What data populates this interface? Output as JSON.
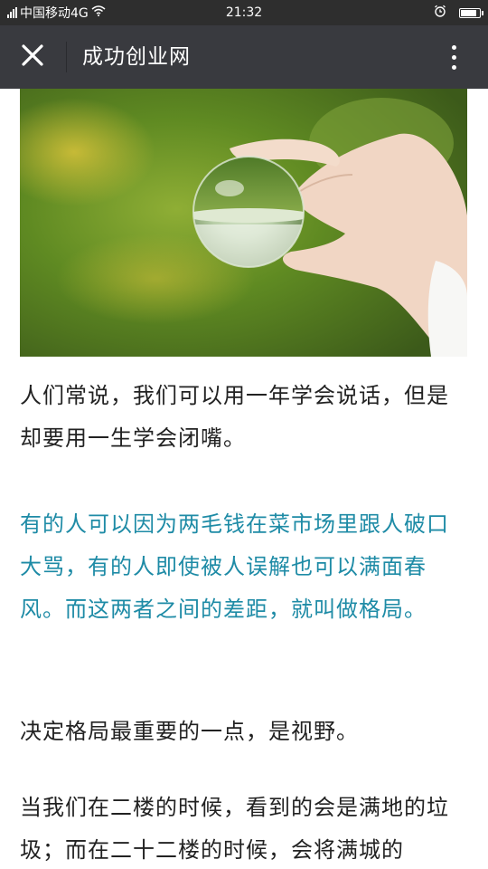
{
  "status_bar": {
    "carrier": "中国移动4G",
    "time": "21:32"
  },
  "app_bar": {
    "title": "成功创业网"
  },
  "article": {
    "image_icon": "crystal-ball-in-hand-photo",
    "paragraphs": [
      {
        "text": "人们常说，我们可以用一年学会说话，但是却要用一生学会闭嘴。",
        "style": "normal"
      },
      {
        "text": "有的人可以因为两毛钱在菜市场里跟人破口大骂，有的人即使被人误解也可以满面春风。而这两者之间的差距，就叫做格局。",
        "style": "accent"
      },
      {
        "text": "决定格局最重要的一点，是视野。",
        "style": "normal"
      },
      {
        "text": "当我们在二楼的时候，看到的会是满地的垃圾；而在二十二楼的时候，会将满城的",
        "style": "normal"
      }
    ]
  },
  "colors": {
    "status_bar": "#2e2e2e",
    "app_bar": "#393a3f",
    "accent_text": "#1e8ba6",
    "body_text": "#222222"
  }
}
